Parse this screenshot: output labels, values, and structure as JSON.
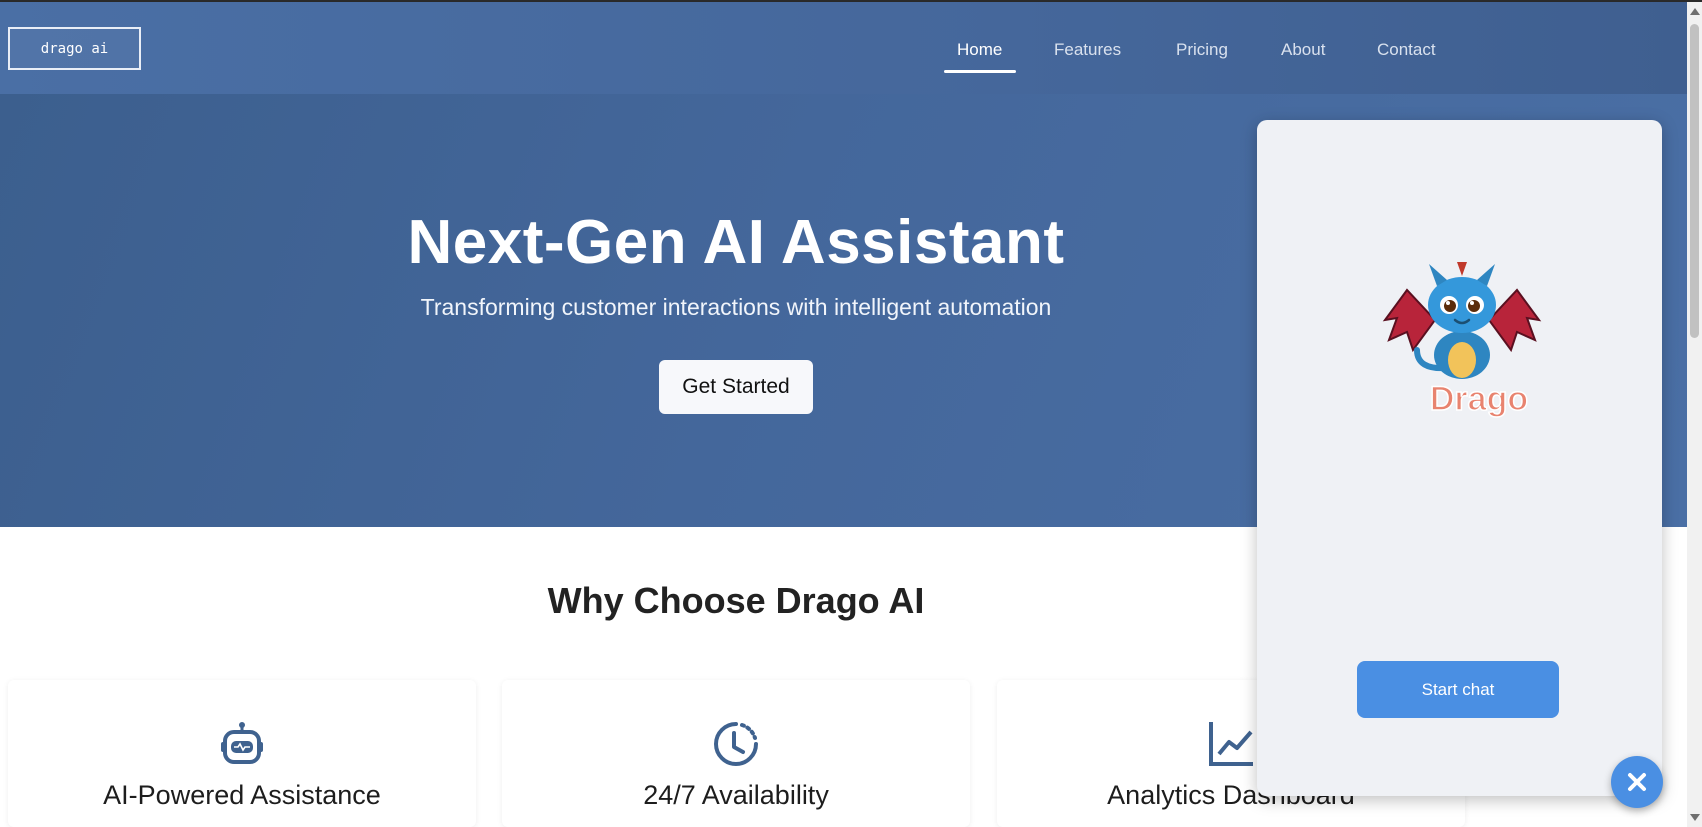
{
  "header": {
    "logo": "drago ai",
    "nav": [
      {
        "label": "Home",
        "active": true
      },
      {
        "label": "Features",
        "active": false
      },
      {
        "label": "Pricing",
        "active": false
      },
      {
        "label": "About",
        "active": false
      },
      {
        "label": "Contact",
        "active": false
      }
    ]
  },
  "hero": {
    "title": "Next-Gen AI Assistant",
    "subtitle": "Transforming customer interactions with intelligent automation",
    "cta_label": "Get Started"
  },
  "why": {
    "title": "Why Choose Drago AI",
    "cards": [
      {
        "icon": "robot-icon",
        "title": "AI-Powered Assistance"
      },
      {
        "icon": "clock-icon",
        "title": "24/7 Availability"
      },
      {
        "icon": "chart-line-icon",
        "title": "Analytics Dashboard"
      }
    ]
  },
  "chat_widget": {
    "mascot_label": "Drago",
    "start_label": "Start chat",
    "close_icon": "close-icon"
  },
  "colors": {
    "nav_bg": "#4a6fa5",
    "hero_bg": "#44679b",
    "accent": "#4a8fe3",
    "icon_color": "#3f628f"
  }
}
